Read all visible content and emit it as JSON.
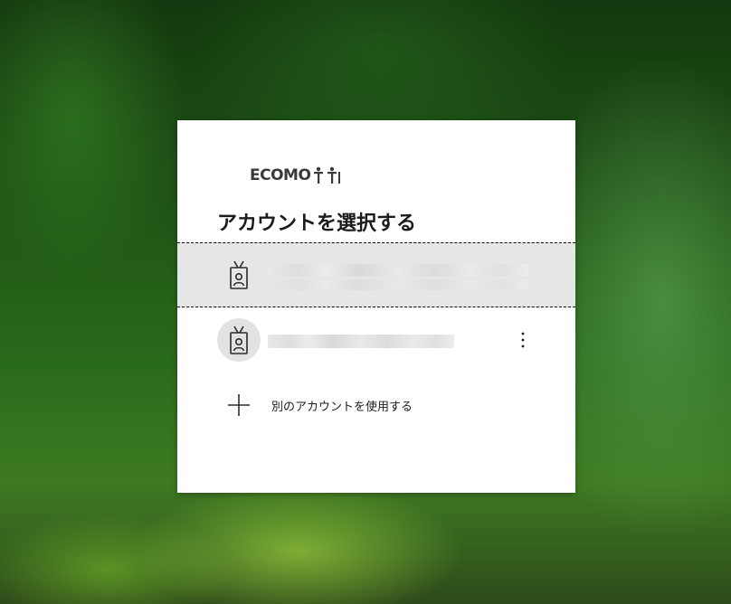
{
  "background": {
    "description_colors": [
      "#14380f",
      "#2a6a1b",
      "#9ec83c"
    ]
  },
  "dialog": {
    "logo_text": "ECOMO",
    "title": "アカウントを選択する",
    "accounts": [
      {
        "state": "selected",
        "icon": "badge-icon"
      },
      {
        "state": "normal",
        "icon": "badge-icon",
        "menu_icon": "more-vertical-icon"
      }
    ],
    "add_account_label": "別のアカウントを使用する",
    "add_icon": "plus-icon"
  }
}
